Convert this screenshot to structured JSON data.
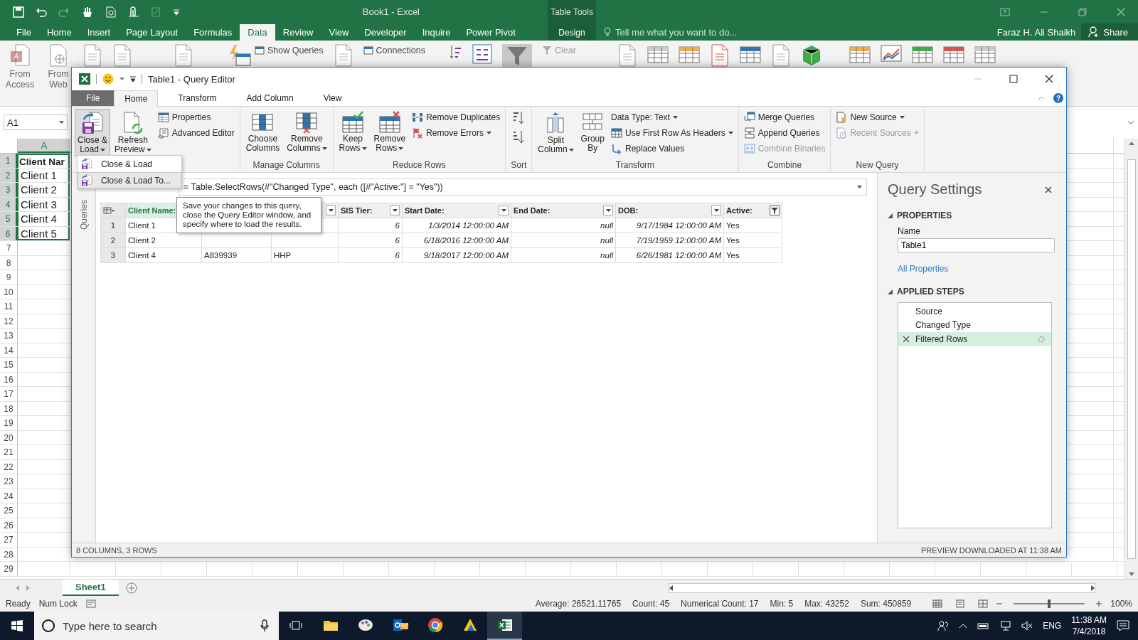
{
  "excel": {
    "title": "Book1 - Excel",
    "context_tab": "Table Tools",
    "tabs": [
      {
        "label": "File",
        "selected": false,
        "contextual": false
      },
      {
        "label": "Home",
        "selected": false,
        "contextual": false
      },
      {
        "label": "Insert",
        "selected": false,
        "contextual": false
      },
      {
        "label": "Page Layout",
        "selected": false,
        "contextual": false
      },
      {
        "label": "Formulas",
        "selected": false,
        "contextual": false
      },
      {
        "label": "Data",
        "selected": true,
        "contextual": false
      },
      {
        "label": "Review",
        "selected": false,
        "contextual": false
      },
      {
        "label": "View",
        "selected": false,
        "contextual": false
      },
      {
        "label": "Developer",
        "selected": false,
        "contextual": false
      },
      {
        "label": "Inquire",
        "selected": false,
        "contextual": false
      },
      {
        "label": "Power Pivot",
        "selected": false,
        "contextual": false
      },
      {
        "label": "Design",
        "selected": false,
        "contextual": true
      }
    ],
    "tell_me": "Tell me what you want to do...",
    "user": "Faraz H. Ali Shaikh",
    "share": "Share",
    "large_buttons": [
      "From\nAccess",
      "From\nWeb"
    ],
    "small_buttons": [
      {
        "label": "Show Queries",
        "disabled": false
      },
      {
        "label": "Connections",
        "disabled": false
      },
      {
        "label": "Clear",
        "disabled": true
      }
    ],
    "name_box": "A1",
    "column_header": "A",
    "rows": [
      {
        "num": "1",
        "value": "Client Nar",
        "kind": "header",
        "selected": true
      },
      {
        "num": "2",
        "value": "Client 1",
        "kind": "data",
        "selected": true
      },
      {
        "num": "3",
        "value": "Client 2",
        "kind": "data",
        "selected": true
      },
      {
        "num": "4",
        "value": "Client 3",
        "kind": "data",
        "selected": true
      },
      {
        "num": "5",
        "value": "Client 4",
        "kind": "data",
        "selected": true
      },
      {
        "num": "6",
        "value": "Client 5",
        "kind": "data",
        "selected": true
      },
      {
        "num": "7",
        "selected": false,
        "kind": "data"
      },
      {
        "num": "8",
        "selected": false,
        "kind": "data"
      },
      {
        "num": "9",
        "selected": false,
        "kind": "data"
      },
      {
        "num": "10",
        "selected": false,
        "kind": "data"
      },
      {
        "num": "11",
        "selected": false,
        "kind": "data"
      },
      {
        "num": "12",
        "selected": false,
        "kind": "data"
      },
      {
        "num": "13",
        "selected": false,
        "kind": "data"
      },
      {
        "num": "14",
        "selected": false,
        "kind": "data"
      },
      {
        "num": "15",
        "selected": false,
        "kind": "data"
      },
      {
        "num": "16",
        "selected": false,
        "kind": "data"
      },
      {
        "num": "17",
        "selected": false,
        "kind": "data"
      },
      {
        "num": "18",
        "selected": false,
        "kind": "data"
      },
      {
        "num": "19",
        "selected": false,
        "kind": "data"
      },
      {
        "num": "20",
        "selected": false,
        "kind": "data"
      },
      {
        "num": "21",
        "selected": false,
        "kind": "data"
      },
      {
        "num": "22",
        "selected": false,
        "kind": "data"
      },
      {
        "num": "23",
        "selected": false,
        "kind": "data"
      },
      {
        "num": "24",
        "selected": false,
        "kind": "data"
      },
      {
        "num": "25",
        "selected": false,
        "kind": "data"
      },
      {
        "num": "26",
        "selected": false,
        "kind": "data"
      },
      {
        "num": "27",
        "selected": false,
        "kind": "data"
      },
      {
        "num": "28",
        "selected": false,
        "kind": "data"
      },
      {
        "num": "29",
        "selected": false,
        "kind": "data"
      }
    ],
    "sheet_tab": "Sheet1",
    "status": {
      "ready": "Ready",
      "num_lock": "Num Lock",
      "stats": [
        "Average: 26521.11765",
        "Count: 45",
        "Numerical Count: 17",
        "Min: 5",
        "Max: 43252",
        "Sum: 450859"
      ],
      "zoom_slider": {
        "level": 0.5
      },
      "zoom": "100%"
    }
  },
  "query_editor": {
    "title": "Table1 - Query Editor",
    "help": "?",
    "tabs": [
      {
        "label": "File",
        "kind": "file",
        "selected": false
      },
      {
        "label": "Home",
        "kind": "tab",
        "selected": true
      },
      {
        "label": "Transform",
        "kind": "tab",
        "selected": false
      },
      {
        "label": "Add Column",
        "kind": "tab",
        "selected": false
      },
      {
        "label": "View",
        "kind": "tab",
        "selected": false
      }
    ],
    "ribbon_groups": [
      {
        "items": [
          {
            "label": "Close &\nLoad",
            "kind": "large",
            "dropdown": true,
            "pressed": true,
            "disabled": false
          },
          {
            "label": "Refresh\nPreview",
            "kind": "large",
            "dropdown": true,
            "pressed": false,
            "disabled": false
          },
          {
            "label": "Properties",
            "kind": "small",
            "dropdown": false,
            "disabled": false
          },
          {
            "label": "Advanced Editor",
            "kind": "small",
            "dropdown": false,
            "disabled": false
          }
        ]
      },
      {
        "label": "Manage Columns",
        "items": [
          {
            "label": "Choose\nColumns",
            "kind": "large",
            "dropdown": false,
            "pressed": false,
            "disabled": false
          },
          {
            "label": "Remove\nColumns",
            "kind": "large",
            "dropdown": true,
            "pressed": false,
            "disabled": false
          }
        ]
      },
      {
        "label": "Reduce Rows",
        "items": [
          {
            "label": "Keep\nRows",
            "kind": "large",
            "dropdown": true,
            "pressed": false,
            "disabled": false
          },
          {
            "label": "Remove\nRows",
            "kind": "large",
            "dropdown": true,
            "pressed": false,
            "disabled": false
          },
          {
            "label": "Remove Duplicates",
            "kind": "small",
            "dropdown": false,
            "disabled": false
          },
          {
            "label": "Remove Errors",
            "kind": "small",
            "dropdown": true,
            "disabled": false
          }
        ]
      },
      {
        "label": "Sort",
        "items": [
          {
            "kind": "icon"
          },
          {
            "kind": "icon"
          }
        ]
      },
      {
        "label": "Transform",
        "items": [
          {
            "label": "Split\nColumn",
            "kind": "large",
            "dropdown": true,
            "pressed": false,
            "disabled": false
          },
          {
            "label": "Group\nBy",
            "kind": "large",
            "dropdown": false,
            "pressed": false,
            "disabled": false
          },
          {
            "label": "Data Type: Text",
            "kind": "small",
            "dropdown": true,
            "disabled": false
          },
          {
            "label": "Use First Row As Headers",
            "kind": "small",
            "dropdown": true,
            "disabled": false
          },
          {
            "label": "Replace Values",
            "kind": "small",
            "dropdown": false,
            "disabled": false
          }
        ]
      },
      {
        "label": "Combine",
        "items": [
          {
            "label": "Merge Queries",
            "kind": "small",
            "dropdown": false,
            "disabled": false
          },
          {
            "label": "Append Queries",
            "kind": "small",
            "dropdown": false,
            "disabled": false
          },
          {
            "label": "Combine Binaries",
            "kind": "small",
            "dropdown": false,
            "disabled": true
          }
        ]
      },
      {
        "label": "New Query",
        "items": [
          {
            "label": "New Source",
            "kind": "small",
            "dropdown": true,
            "disabled": false
          },
          {
            "label": "Recent Sources",
            "kind": "small",
            "dropdown": true,
            "disabled": true
          }
        ]
      }
    ],
    "dropdown_menu": [
      {
        "label": "Close & Load",
        "selected": false
      },
      {
        "label": "Close & Load To...",
        "selected": true
      }
    ],
    "tooltip": "Save your changes to this query, close the Query Editor window, and specify where to load the results.",
    "queries_pane": "Queries",
    "formula": "= Table.SelectRows(#\"Changed Type\", each ([#\"Active:\"] = \"Yes\"))",
    "table": {
      "columns": [
        {
          "label": "Client Name:",
          "kind": "text",
          "selected": true,
          "filtered": false
        },
        {
          "kind": "text"
        },
        {
          "kind": "text"
        },
        {
          "label": "SIS Tier:",
          "kind": "number",
          "selected": false,
          "filtered": false
        },
        {
          "label": "Start Date:",
          "kind": "date",
          "selected": false,
          "filtered": false
        },
        {
          "label": "End Date:",
          "kind": "date",
          "selected": false,
          "filtered": false
        },
        {
          "label": "DOB:",
          "kind": "date",
          "selected": false,
          "filtered": false
        },
        {
          "label": "Active:",
          "kind": "text",
          "selected": false,
          "filtered": true
        }
      ],
      "rows": [
        {
          "num": "1",
          "cells": [
            "Client 1",
            null,
            null,
            "6",
            "1/3/2014 12:00:00 AM",
            "null",
            "9/17/1984 12:00:00 AM",
            "Yes"
          ]
        },
        {
          "num": "2",
          "cells": [
            "Client 2",
            null,
            null,
            "6",
            "6/18/2016 12:00:00 AM",
            "null",
            "7/19/1959 12:00:00 AM",
            "Yes"
          ]
        },
        {
          "num": "3",
          "cells": [
            "Client 4",
            "A839939",
            "HHP",
            "6",
            "9/18/2017 12:00:00 AM",
            "null",
            "6/26/1981 12:00:00 AM",
            "Yes"
          ]
        }
      ]
    },
    "settings": {
      "title": "Query Settings",
      "properties_heading": "PROPERTIES",
      "name_label": "Name",
      "name_value": "Table1",
      "all_properties": "All Properties",
      "steps_heading": "APPLIED STEPS",
      "steps": [
        {
          "label": "Source",
          "selected": false
        },
        {
          "label": "Changed Type",
          "selected": false
        },
        {
          "label": "Filtered Rows",
          "selected": true
        }
      ]
    },
    "status_left": "8 COLUMNS, 3 ROWS",
    "status_right": "PREVIEW DOWNLOADED AT 11:38 AM"
  },
  "taskbar": {
    "search_placeholder": "Type here to search",
    "apps": [
      {
        "kind": "folder",
        "selected": false
      },
      {
        "kind": "palette",
        "selected": false
      },
      {
        "kind": "mail",
        "selected": false
      },
      {
        "kind": "browser",
        "selected": false
      },
      {
        "kind": "chart",
        "selected": false
      },
      {
        "kind": "spreadsheet",
        "selected": true
      }
    ],
    "language": "ENG",
    "time": "11:38 AM",
    "date": "7/4/2018"
  }
}
